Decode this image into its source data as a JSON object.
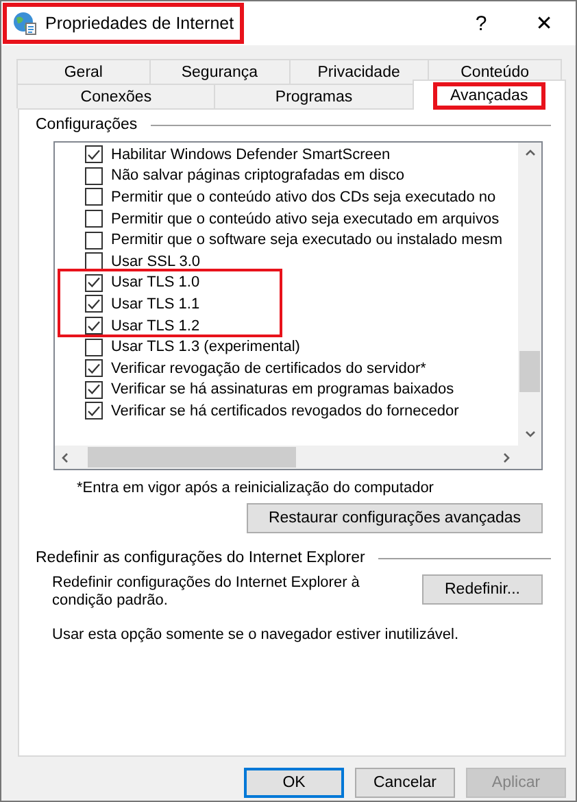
{
  "window": {
    "title": "Propriedades de Internet",
    "title_highlighted": true,
    "help": "?",
    "close": "✕"
  },
  "tab_rows": [
    [
      {
        "label": "Geral",
        "selected": false,
        "highlighted": false
      },
      {
        "label": "Segurança",
        "selected": false,
        "highlighted": false
      },
      {
        "label": "Privacidade",
        "selected": false,
        "highlighted": false
      },
      {
        "label": "Conteúdo",
        "selected": false,
        "highlighted": false
      }
    ],
    [
      {
        "label": "Conexões",
        "selected": false,
        "highlighted": false
      },
      {
        "label": "Programas",
        "selected": false,
        "highlighted": false
      },
      {
        "label": "Avançadas",
        "selected": true,
        "highlighted": true
      }
    ]
  ],
  "settings": {
    "title": "Configurações",
    "items": [
      {
        "label": "Habilitar Windows Defender SmartScreen",
        "checked": true,
        "highlighted": false
      },
      {
        "label": "Não salvar páginas criptografadas em disco",
        "checked": false,
        "highlighted": false
      },
      {
        "label": "Permitir que o conteúdo ativo dos CDs seja executado no",
        "checked": false,
        "highlighted": false
      },
      {
        "label": "Permitir que o conteúdo ativo seja executado em arquivos",
        "checked": false,
        "highlighted": false
      },
      {
        "label": "Permitir que o software seja executado ou instalado mesm",
        "checked": false,
        "highlighted": false
      },
      {
        "label": "Usar SSL 3.0",
        "checked": false,
        "highlighted": false
      },
      {
        "label": "Usar TLS 1.0",
        "checked": true,
        "highlighted": true
      },
      {
        "label": "Usar TLS 1.1",
        "checked": true,
        "highlighted": true
      },
      {
        "label": "Usar TLS 1.2",
        "checked": true,
        "highlighted": true
      },
      {
        "label": "Usar TLS 1.3 (experimental)",
        "checked": false,
        "highlighted": false
      },
      {
        "label": "Verificar revogação de certificados do servidor*",
        "checked": true,
        "highlighted": false
      },
      {
        "label": "Verificar se há assinaturas em programas baixados",
        "checked": true,
        "highlighted": false
      },
      {
        "label": "Verificar se há certificados revogados do fornecedor",
        "checked": true,
        "highlighted": false
      }
    ],
    "footnote": "*Entra em vigor após a reinicialização do computador",
    "restore_button": "Restaurar configurações avançadas"
  },
  "reset": {
    "title": "Redefinir as configurações do Internet Explorer",
    "description": "Redefinir configurações do Internet Explorer à condição padrão.",
    "button": "Redefinir...",
    "note": "Usar esta opção somente se o navegador estiver inutilizável."
  },
  "buttons": [
    {
      "label": "OK",
      "disabled": false,
      "default": true
    },
    {
      "label": "Cancelar",
      "disabled": false,
      "default": false
    },
    {
      "label": "Aplicar",
      "disabled": true,
      "default": false
    }
  ]
}
